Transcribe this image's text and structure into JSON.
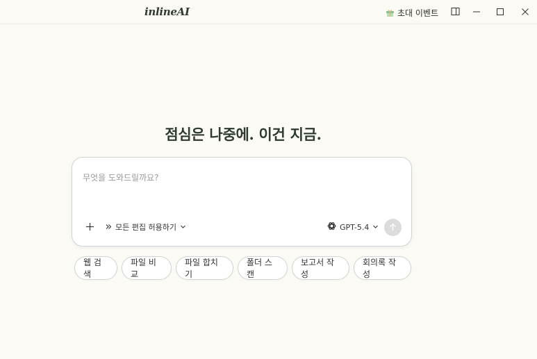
{
  "app": {
    "logo_text": "inlineAI"
  },
  "titlebar": {
    "invite_label": "초대 이벤트",
    "invite_icon": "gift-icon",
    "sidebar_toggle_icon": "sidebar-toggle-icon",
    "minimize_icon": "minimize-icon",
    "maximize_icon": "maximize-icon",
    "close_icon": "close-icon"
  },
  "main": {
    "headline": "점심은 나중에. 이건 지금."
  },
  "composer": {
    "placeholder": "무엇을 도와드릴까요?",
    "value": "",
    "attach_icon": "plus-icon",
    "edit_mode_label": "모든 편집 허용하기",
    "model_label": "GPT-5.4",
    "send_icon": "arrow-up-icon"
  },
  "quick_actions": [
    {
      "label": "웹 검색"
    },
    {
      "label": "파일 비교"
    },
    {
      "label": "파일 합치기"
    },
    {
      "label": "폴더 스캔"
    },
    {
      "label": "보고서 작성"
    },
    {
      "label": "회의록 작성"
    }
  ],
  "colors": {
    "background": "#fbfaf5",
    "headline": "#2c3a31",
    "border": "#cfd6d2",
    "send_disabled": "#dcdcdc"
  }
}
